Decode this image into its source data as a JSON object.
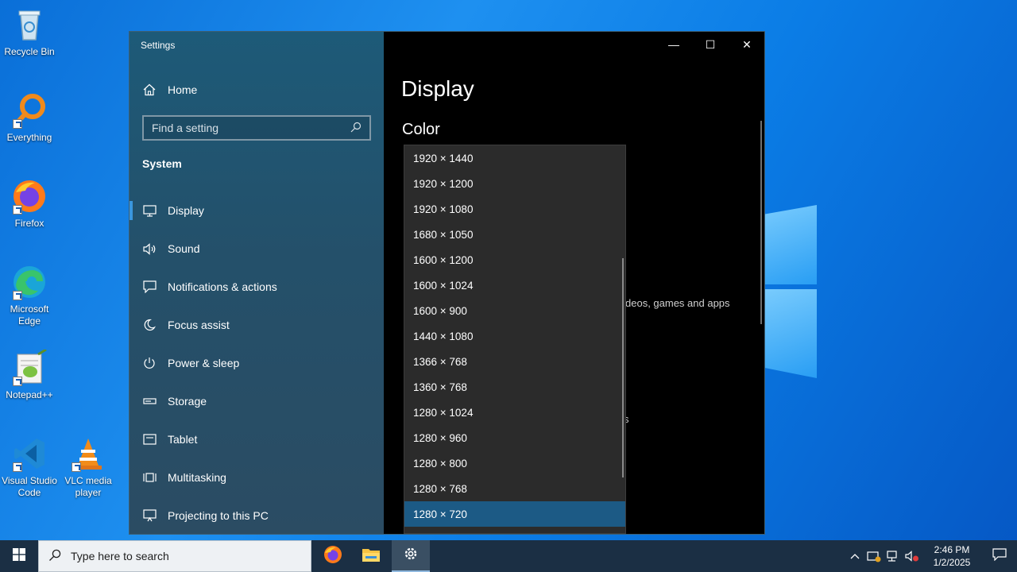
{
  "desktop": {
    "icons": [
      {
        "label": "Recycle Bin"
      },
      {
        "label": "Everything"
      },
      {
        "label": "Firefox"
      },
      {
        "label": "Microsoft Edge"
      },
      {
        "label": "Notepad++"
      },
      {
        "label": "Visual Studio Code"
      },
      {
        "label": "VLC media player"
      }
    ]
  },
  "window": {
    "title": "Settings",
    "controls": {
      "minimize": "—",
      "maximize": "☐",
      "close": "✕"
    }
  },
  "nav": {
    "home_label": "Home",
    "search_placeholder": "Find a setting",
    "section_title": "System",
    "items": [
      {
        "label": "Display",
        "icon": "monitor-icon",
        "selected": true
      },
      {
        "label": "Sound",
        "icon": "speaker-icon"
      },
      {
        "label": "Notifications & actions",
        "icon": "notification-icon"
      },
      {
        "label": "Focus assist",
        "icon": "moon-icon"
      },
      {
        "label": "Power & sleep",
        "icon": "power-icon"
      },
      {
        "label": "Storage",
        "icon": "storage-icon"
      },
      {
        "label": "Tablet",
        "icon": "tablet-icon"
      },
      {
        "label": "Multitasking",
        "icon": "multitasking-icon"
      },
      {
        "label": "Projecting to this PC",
        "icon": "projecting-icon"
      }
    ]
  },
  "content": {
    "page_title": "Display",
    "section_title": "Color",
    "peek_text": "deos, games and apps",
    "peek_mark": "s"
  },
  "resolution_dropdown": {
    "options": [
      "1920 × 1440",
      "1920 × 1200",
      "1920 × 1080",
      "1680 × 1050",
      "1600 × 1200",
      "1600 × 1024",
      "1600 × 900",
      "1440 × 1080",
      "1366 × 768",
      "1360 × 768",
      "1280 × 1024",
      "1280 × 960",
      "1280 × 800",
      "1280 × 768",
      "1280 × 720"
    ],
    "selected": "1280 × 720"
  },
  "taskbar": {
    "search_placeholder": "Type here to search",
    "time": "2:46 PM",
    "date": "1/2/2025"
  },
  "colors": {
    "accent": "#3a96dd",
    "selected_item": "#1c5a85",
    "dropdown_bg": "#2b2b2b",
    "taskbar_bg": "#1b2f44"
  }
}
